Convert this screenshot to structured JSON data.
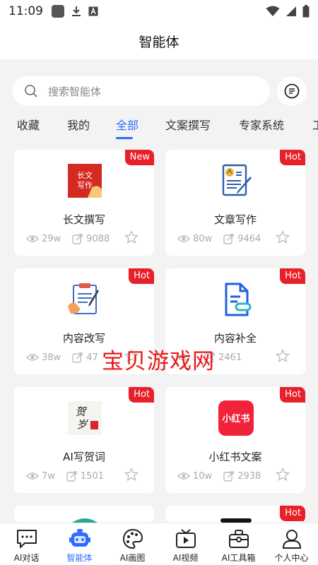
{
  "status_bar": {
    "time": "11:09"
  },
  "header": {
    "title": "智能体"
  },
  "search": {
    "placeholder": "搜索智能体"
  },
  "tabs": [
    {
      "label": "收藏"
    },
    {
      "label": "我的"
    },
    {
      "label": "全部"
    },
    {
      "label": "文案撰写"
    },
    {
      "label": "专家系统"
    },
    {
      "label": "工"
    }
  ],
  "active_tab": "全部",
  "cards": [
    {
      "title": "长文撰写",
      "badge": "New",
      "views": "29w",
      "uses": "9088",
      "icon": "long-text-writing-icon"
    },
    {
      "title": "文章写作",
      "badge": "Hot",
      "views": "80w",
      "uses": "9464",
      "icon": "article-writing-icon"
    },
    {
      "title": "内容改写",
      "badge": "Hot",
      "views": "38w",
      "uses": "47",
      "icon": "content-rewrite-icon"
    },
    {
      "title": "内容补全",
      "badge": "Hot",
      "views": "",
      "uses": "2461",
      "icon": "content-complete-icon"
    },
    {
      "title": "AI写贺词",
      "badge": "Hot",
      "views": "7w",
      "uses": "1501",
      "icon": "greeting-writing-icon"
    },
    {
      "title": "小红书文案",
      "badge": "Hot",
      "views": "10w",
      "uses": "2938",
      "icon": "xiaohongshu-icon",
      "icon_text": "小红书"
    },
    {
      "title": "",
      "badge": "",
      "views": "",
      "uses": ""
    },
    {
      "title": "",
      "badge": "Hot",
      "views": "",
      "uses": ""
    }
  ],
  "card_icon_text": {
    "long_text": [
      "长文",
      "写作"
    ],
    "greeting": [
      "贺",
      "岁"
    ]
  },
  "watermark": "宝贝游戏网",
  "bottom_nav": [
    {
      "label": "AI对话",
      "icon": "chat-icon"
    },
    {
      "label": "智能体",
      "icon": "robot-icon"
    },
    {
      "label": "AI画图",
      "icon": "palette-icon"
    },
    {
      "label": "AI视频",
      "icon": "video-icon"
    },
    {
      "label": "AI工具箱",
      "icon": "toolbox-icon"
    },
    {
      "label": "个人中心",
      "icon": "person-icon"
    }
  ],
  "colors": {
    "accent": "#2f6bff",
    "badge": "#e8202a",
    "background": "#f3f3f3"
  }
}
